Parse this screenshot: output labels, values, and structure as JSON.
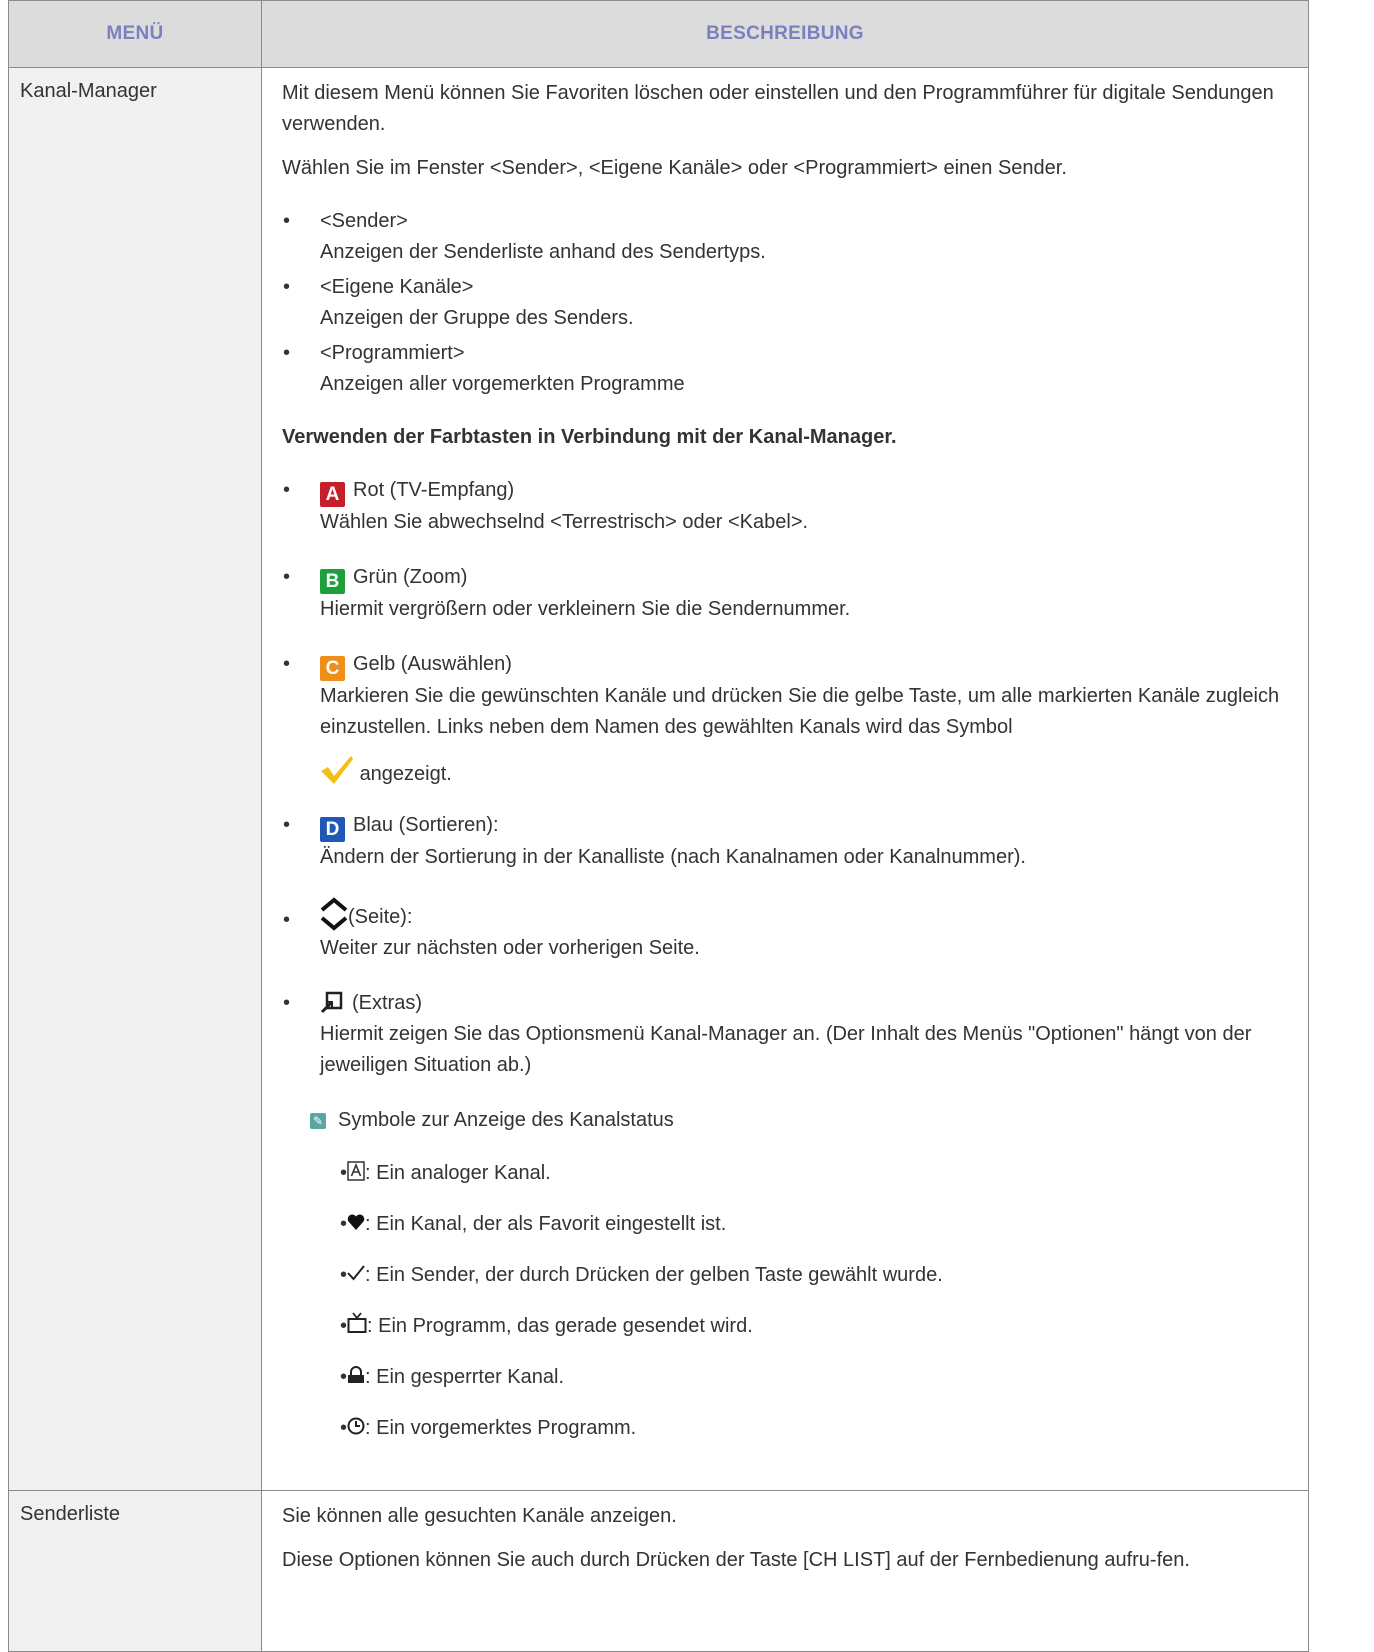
{
  "table": {
    "headers": {
      "menu": "MENÜ",
      "description": "BESCHREIBUNG"
    },
    "rows": [
      {
        "menu": "Kanal-Manager",
        "intro": "Mit diesem Menü können Sie Favoriten löschen oder einstellen und den Programmführer für digitale Sendungen verwenden.",
        "select_text": "Wählen Sie im Fenster <Sender>, <Eigene Kanäle> oder <Programmiert> einen Sender.",
        "options": [
          {
            "title": "<Sender>",
            "desc": "Anzeigen der Senderliste anhand des Sendertyps."
          },
          {
            "title": "<Eigene Kanäle>",
            "desc": "Anzeigen der Gruppe des Senders."
          },
          {
            "title": "<Programmiert>",
            "desc": "Anzeigen aller vorgemerkten Programme"
          }
        ],
        "color_heading": "Verwenden der Farbtasten in Verbindung mit der Kanal-Manager.",
        "color_buttons": [
          {
            "key": "A",
            "label": "Rot (TV-Empfang)",
            "desc": "Wählen Sie abwechselnd <Terrestrisch> oder <Kabel>.",
            "color": "#c41f2b"
          },
          {
            "key": "B",
            "label": "Grün (Zoom)",
            "desc": "Hiermit vergrößern oder verkleinern Sie die Sendernummer.",
            "color": "#1f9e3c"
          },
          {
            "key": "C",
            "label": "Gelb (Auswählen)",
            "desc": "Markieren Sie die gewünschten Kanäle und drücken Sie die gelbe Taste, um alle markierten Kanäle zugleich einzustellen. Links neben dem Namen des gewählten Kanals wird das Symbol",
            "desc_after_icon": "angezeigt.",
            "color": "#f08e1a"
          },
          {
            "key": "D",
            "label": "Blau (Sortieren):",
            "desc": "Ändern der Sortierung in der Kanalliste (nach Kanalnamen oder Kanalnummer).",
            "color": "#1f58b7"
          }
        ],
        "page_button": {
          "label": "(Seite):",
          "desc": "Weiter zur nächsten oder vorherigen Seite.",
          "icon": "page-up-down-icon"
        },
        "extras_button": {
          "label": "(Extras)",
          "desc": "Hiermit zeigen Sie das Optionsmenü Kanal-Manager an. (Der Inhalt des Menüs \"Optionen\" hängt von der jeweiligen Situation ab.)",
          "icon": "tools-icon"
        },
        "note_title": "Symbole zur Anzeige des Kanalstatus",
        "status_symbols": [
          {
            "icon": "analog-channel-icon",
            "text": ": Ein analoger Kanal."
          },
          {
            "icon": "heart-icon",
            "text": ": Ein Kanal, der als Favorit eingestellt ist."
          },
          {
            "icon": "checkmark-icon",
            "text": ": Ein Sender, der durch Drücken der gelben Taste gewählt wurde."
          },
          {
            "icon": "tv-icon",
            "text": ": Ein Programm, das gerade gesendet wird."
          },
          {
            "icon": "lock-icon",
            "text": ": Ein gesperrter Kanal."
          },
          {
            "icon": "clock-icon",
            "text": ": Ein vorgemerktes Programm."
          }
        ]
      },
      {
        "menu": "Senderliste",
        "line1": "Sie können alle gesuchten Kanäle anzeigen.",
        "line2": "Diese Optionen können Sie auch durch Drücken der Taste [CH LIST] auf der Fernbedienung aufru-fen."
      }
    ]
  }
}
